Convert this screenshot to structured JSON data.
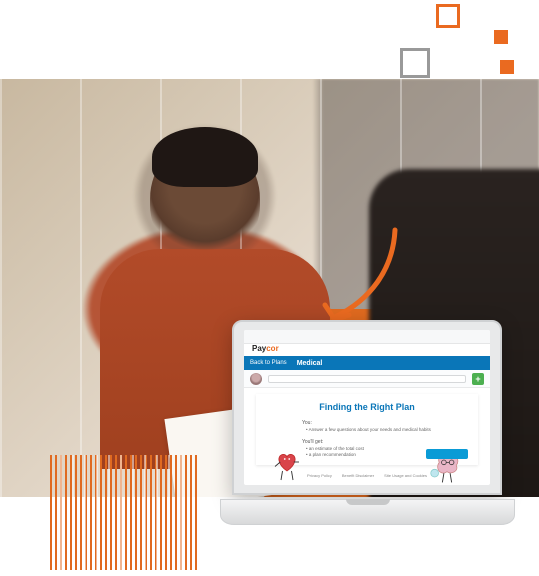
{
  "decor": {
    "squares": true
  },
  "laptop": {
    "brand_prefix": "Pay",
    "brand_suffix": "cor",
    "back_label": "Back to Plans",
    "section_label": "Medical",
    "add_button": "+",
    "card": {
      "title": "Finding the Right Plan",
      "you_label": "You:",
      "you_line": "Answer a few questions about your needs and medical habits",
      "youget_label": "You'll get:",
      "youget_line1": "an estimate of the total cost",
      "youget_line2": "a plan recommendation"
    },
    "footer": {
      "a": "Privacy Policy",
      "b": "Benefit Disclaimer",
      "c": "Site Usage and Cookies"
    }
  }
}
